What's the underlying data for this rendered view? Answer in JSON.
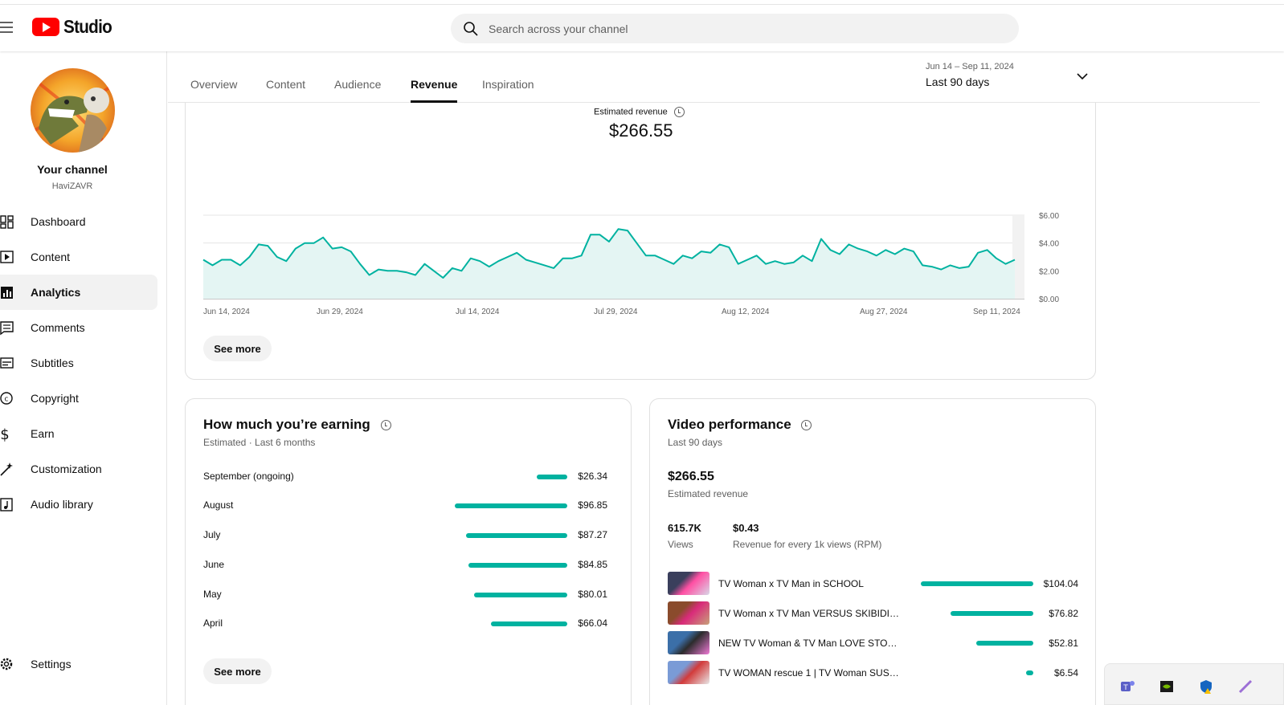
{
  "app": {
    "logo_text": "Studio"
  },
  "search": {
    "placeholder": "Search across your channel"
  },
  "channel": {
    "title": "Your channel",
    "handle": "HaviZAVR"
  },
  "sidebar": {
    "items": [
      {
        "label": "Dashboard",
        "icon": "dashboard-icon"
      },
      {
        "label": "Content",
        "icon": "content-icon"
      },
      {
        "label": "Analytics",
        "icon": "analytics-icon",
        "active": true
      },
      {
        "label": "Comments",
        "icon": "comments-icon"
      },
      {
        "label": "Subtitles",
        "icon": "subtitles-icon"
      },
      {
        "label": "Copyright",
        "icon": "copyright-icon"
      },
      {
        "label": "Earn",
        "icon": "earn-icon"
      },
      {
        "label": "Customization",
        "icon": "customization-icon"
      },
      {
        "label": "Audio library",
        "icon": "audio-library-icon"
      }
    ],
    "settings_label": "Settings"
  },
  "tabs": [
    {
      "label": "Overview"
    },
    {
      "label": "Content"
    },
    {
      "label": "Audience"
    },
    {
      "label": "Revenue",
      "active": true
    },
    {
      "label": "Inspiration"
    }
  ],
  "date_range": {
    "dates": "Jun 14 – Sep 11, 2024",
    "label": "Last 90 days"
  },
  "revenue_card": {
    "label": "Estimated revenue",
    "value": "$266.55",
    "see_more": "See more"
  },
  "chart_data": {
    "type": "area",
    "x_tick_labels": [
      "Jun 14, 2024",
      "Jun 29, 2024",
      "Jul 14, 2024",
      "Jul 29, 2024",
      "Aug 12, 2024",
      "Aug 27, 2024",
      "Sep 11, 2024"
    ],
    "y_tick_labels": [
      "$6.00",
      "$4.00",
      "$2.00",
      "$0.00"
    ],
    "ylim": [
      0,
      6
    ],
    "start": "Jun 14, 2024",
    "values": [
      2.8,
      2.4,
      2.8,
      2.8,
      2.4,
      3.0,
      3.9,
      3.8,
      3.0,
      2.7,
      3.6,
      4.0,
      4.0,
      4.4,
      3.6,
      3.7,
      3.4,
      2.5,
      1.7,
      2.1,
      2.0,
      2.0,
      1.9,
      1.7,
      2.5,
      2.0,
      1.5,
      2.2,
      2.0,
      2.9,
      2.7,
      2.3,
      2.7,
      3.0,
      3.3,
      2.8,
      2.6,
      2.4,
      2.2,
      2.9,
      2.9,
      3.1,
      4.6,
      4.6,
      4.1,
      5.0,
      4.9,
      4.0,
      3.1,
      3.1,
      2.8,
      2.5,
      3.1,
      2.9,
      3.4,
      3.3,
      3.9,
      3.7,
      2.5,
      2.8,
      3.1,
      2.5,
      2.7,
      2.5,
      2.6,
      3.1,
      2.7,
      4.3,
      3.5,
      3.2,
      3.9,
      3.6,
      3.4,
      3.1,
      3.5,
      3.2,
      3.6,
      3.4,
      2.4,
      2.3,
      2.1,
      2.4,
      2.2,
      2.3,
      3.3,
      3.5,
      2.9,
      2.5,
      2.8
    ],
    "colors": {
      "line": "#00b2a0",
      "fill": "#e4f5f3",
      "grid": "#e5e5e5"
    },
    "grid": true
  },
  "earnings": {
    "title": "How much you’re earning",
    "subtitle": "Estimated · Last 6 months",
    "rows": [
      {
        "label": "September (ongoing)",
        "value": "$26.34",
        "amount": 26.34
      },
      {
        "label": "August",
        "value": "$96.85",
        "amount": 96.85
      },
      {
        "label": "July",
        "value": "$87.27",
        "amount": 87.27
      },
      {
        "label": "June",
        "value": "$84.85",
        "amount": 84.85
      },
      {
        "label": "May",
        "value": "$80.01",
        "amount": 80.01
      },
      {
        "label": "April",
        "value": "$66.04",
        "amount": 66.04
      }
    ],
    "see_more": "See more"
  },
  "video_performance": {
    "title": "Video performance",
    "subtitle": "Last 90 days",
    "revenue_value": "$266.55",
    "revenue_label": "Estimated revenue",
    "views_value": "615.7K",
    "views_label": "Views",
    "rpm_value": "$0.43",
    "rpm_label": "Revenue for every 1k views (RPM)",
    "videos": [
      {
        "title": "TV Woman x TV Man in SCHOOL",
        "value": "$104.04",
        "amount": 104.04
      },
      {
        "title": "TV Woman x TV Man VERSUS SKIBIDI T...",
        "value": "$76.82",
        "amount": 76.82
      },
      {
        "title": "NEW TV Woman & TV Man LOVE STORY...",
        "value": "$52.81",
        "amount": 52.81
      },
      {
        "title": "TV WOMAN rescue 1 | TV Woman SUS L...",
        "value": "$6.54",
        "amount": 6.54
      }
    ]
  },
  "accent_color": "#00b2a0"
}
